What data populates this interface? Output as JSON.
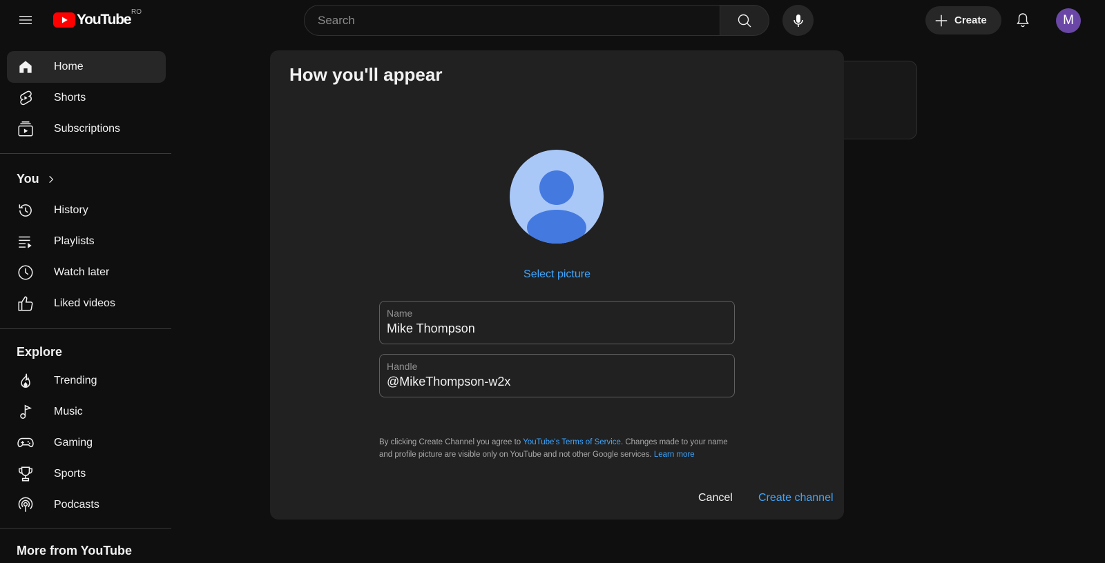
{
  "masthead": {
    "logo_text": "YouTube",
    "country_code": "RO",
    "search_placeholder": "Search",
    "create_label": "Create",
    "avatar_letter": "M",
    "avatar_color": "#6a47a6"
  },
  "sidebar": {
    "main_items": [
      {
        "label": "Home",
        "icon": "home-icon",
        "active": true
      },
      {
        "label": "Shorts",
        "icon": "shorts-icon"
      },
      {
        "label": "Subscriptions",
        "icon": "subscriptions-icon"
      }
    ],
    "you_title": "You",
    "you_items": [
      {
        "label": "History",
        "icon": "history-icon"
      },
      {
        "label": "Playlists",
        "icon": "playlists-icon"
      },
      {
        "label": "Watch later",
        "icon": "clock-icon"
      },
      {
        "label": "Liked videos",
        "icon": "thumbs-up-icon"
      }
    ],
    "explore_title": "Explore",
    "explore_items": [
      {
        "label": "Trending",
        "icon": "trending-icon"
      },
      {
        "label": "Music",
        "icon": "music-icon"
      },
      {
        "label": "Gaming",
        "icon": "gaming-icon"
      },
      {
        "label": "Sports",
        "icon": "trophy-icon"
      },
      {
        "label": "Podcasts",
        "icon": "podcast-icon"
      }
    ],
    "more_title": "More from YouTube"
  },
  "dialog": {
    "title": "How you'll appear",
    "select_picture": "Select picture",
    "name_label": "Name",
    "name_value": "Mike Thompson",
    "handle_label": "Handle",
    "handle_value": "@MikeThompson-w2x",
    "legal_prefix": "By clicking Create Channel you agree to ",
    "legal_tos_link": "YouTube's Terms of Service",
    "legal_middle": ". Changes made to your name and profile picture are visible only on YouTube and not other Google services. ",
    "legal_learn_more": "Learn more",
    "cancel_label": "Cancel",
    "create_label": "Create channel"
  },
  "colors": {
    "background": "#0f0f0f",
    "dialog": "#212121",
    "accent_blue": "#3ea6ff",
    "youtube_red": "#ff0000"
  }
}
